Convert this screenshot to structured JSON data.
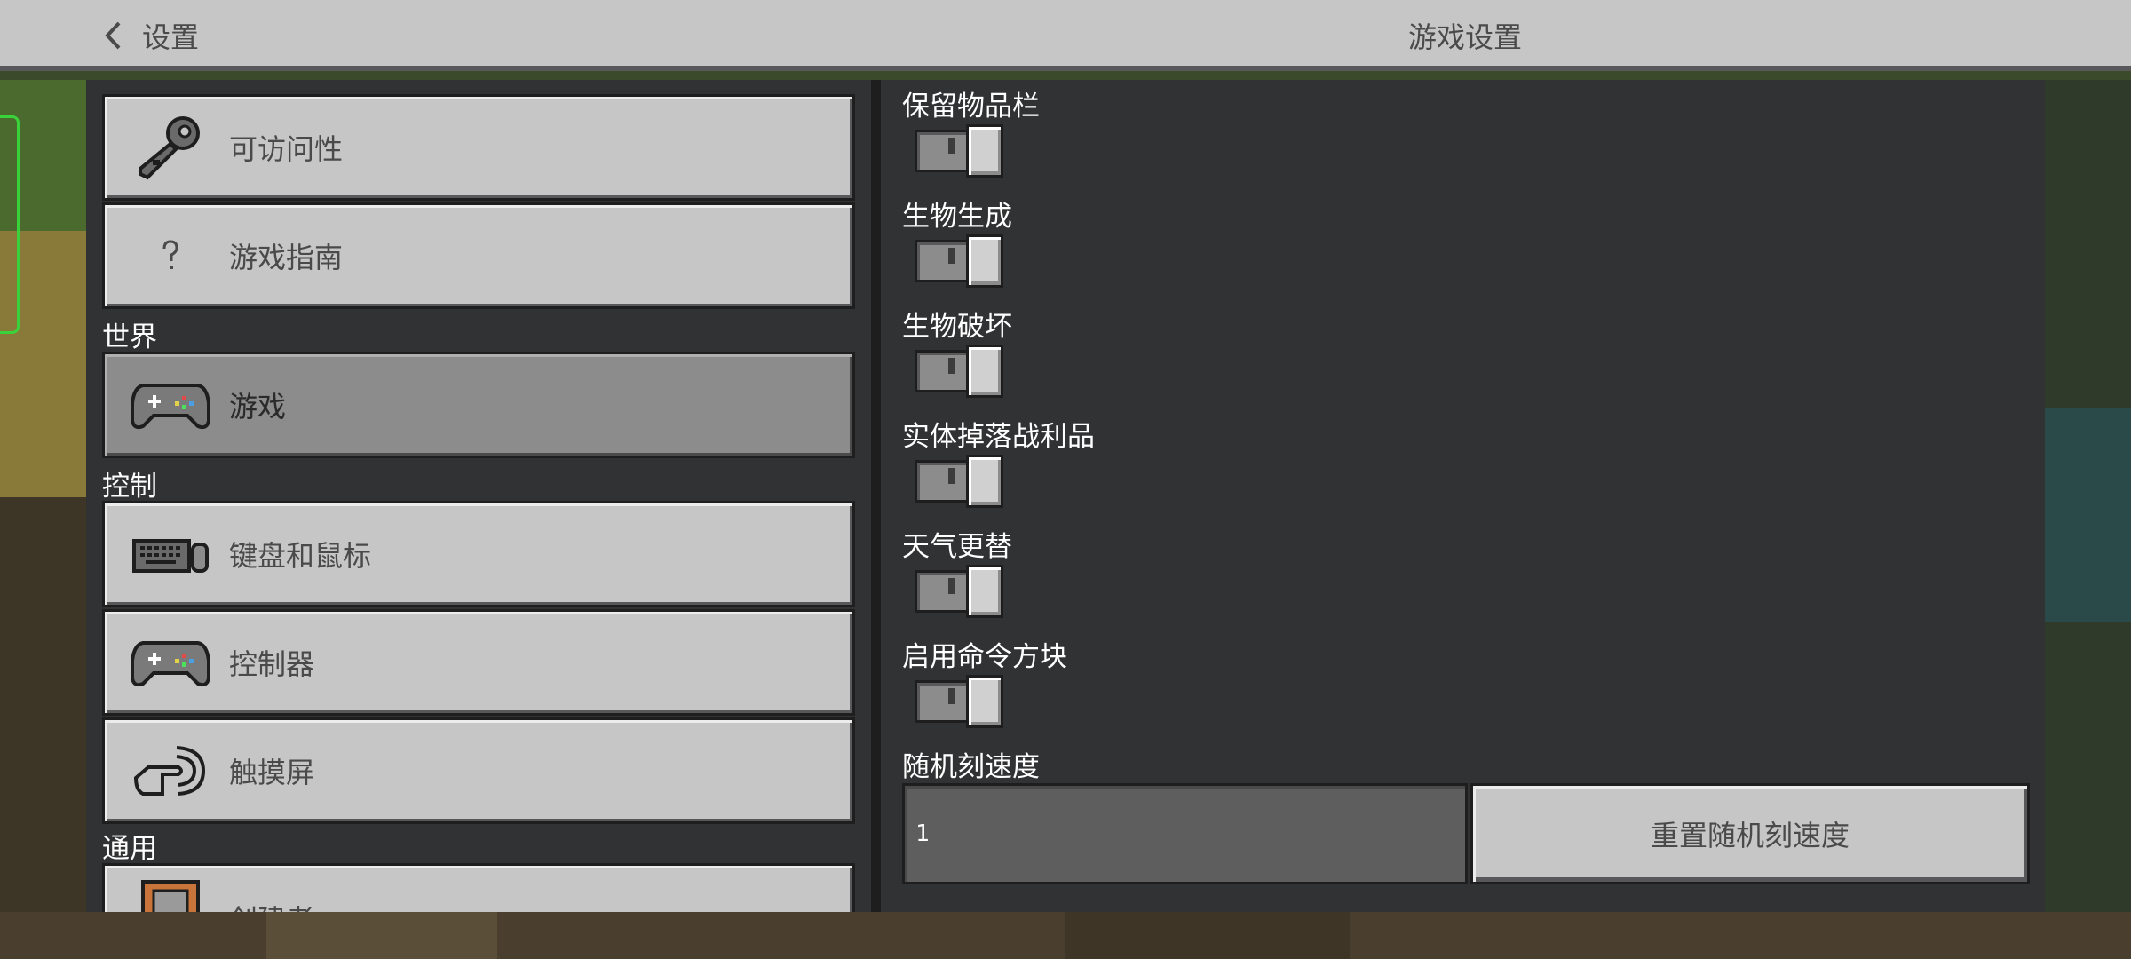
{
  "header": {
    "back_label": "设置",
    "title": "游戏设置"
  },
  "sidebar": {
    "items_top": [
      {
        "label": "可访问性",
        "icon": "key-icon"
      },
      {
        "label": "游戏指南",
        "icon": "question-icon"
      }
    ],
    "sections": [
      {
        "title": "世界",
        "items": [
          {
            "label": "游戏",
            "icon": "gamepad-icon",
            "selected": true
          }
        ]
      },
      {
        "title": "控制",
        "items": [
          {
            "label": "键盘和鼠标",
            "icon": "keyboard-mouse-icon"
          },
          {
            "label": "控制器",
            "icon": "gamepad-icon"
          },
          {
            "label": "触摸屏",
            "icon": "touch-icon"
          }
        ]
      },
      {
        "title": "通用",
        "items": [
          {
            "label": "创建者",
            "icon": "creator-icon"
          }
        ]
      }
    ]
  },
  "settings": {
    "toggles": [
      {
        "label": "保留物品栏",
        "on": false
      },
      {
        "label": "生物生成",
        "on": false
      },
      {
        "label": "生物破坏",
        "on": false
      },
      {
        "label": "实体掉落战利品",
        "on": false
      },
      {
        "label": "天气更替",
        "on": false
      },
      {
        "label": "启用命令方块",
        "on": false
      }
    ],
    "random_tick": {
      "label": "随机刻速度",
      "value": "1",
      "reset_label": "重置随机刻速度"
    }
  },
  "colors": {
    "panel": "#313233",
    "button": "#c6c6c6",
    "button_selected": "#8c8c8c",
    "text_dark": "#4a4a4a",
    "text_light": "#ffffff"
  }
}
